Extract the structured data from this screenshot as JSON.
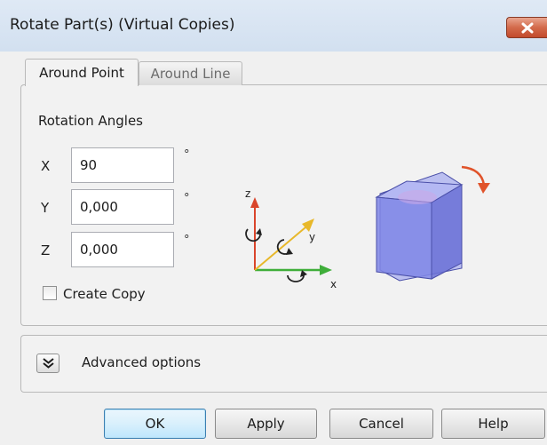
{
  "window": {
    "title": "Rotate Part(s) (Virtual Copies)",
    "close_icon": "close-icon"
  },
  "tabs": [
    {
      "label": "Around Point",
      "active": true
    },
    {
      "label": "Around Line",
      "active": false
    }
  ],
  "rotation": {
    "section_label": "Rotation Angles",
    "degree_symbol": "°",
    "fields": [
      {
        "axis": "X",
        "value": "90"
      },
      {
        "axis": "Y",
        "value": "0,000"
      },
      {
        "axis": "Z",
        "value": "0,000"
      }
    ]
  },
  "create_copy": {
    "label": "Create Copy",
    "checked": false
  },
  "axes_diagram": {
    "x_label": "x",
    "y_label": "y",
    "z_label": "z"
  },
  "advanced": {
    "label": "Advanced options",
    "icon": "double-chevron-down-icon"
  },
  "buttons": {
    "ok": "OK",
    "apply": "Apply",
    "cancel": "Cancel",
    "help": "Help"
  },
  "colors": {
    "x_axis": "#3fae3a",
    "y_axis": "#e8b82a",
    "z_axis": "#d9452b",
    "cube": "#7f86e6",
    "rotate_arrow": "#e0532a"
  }
}
